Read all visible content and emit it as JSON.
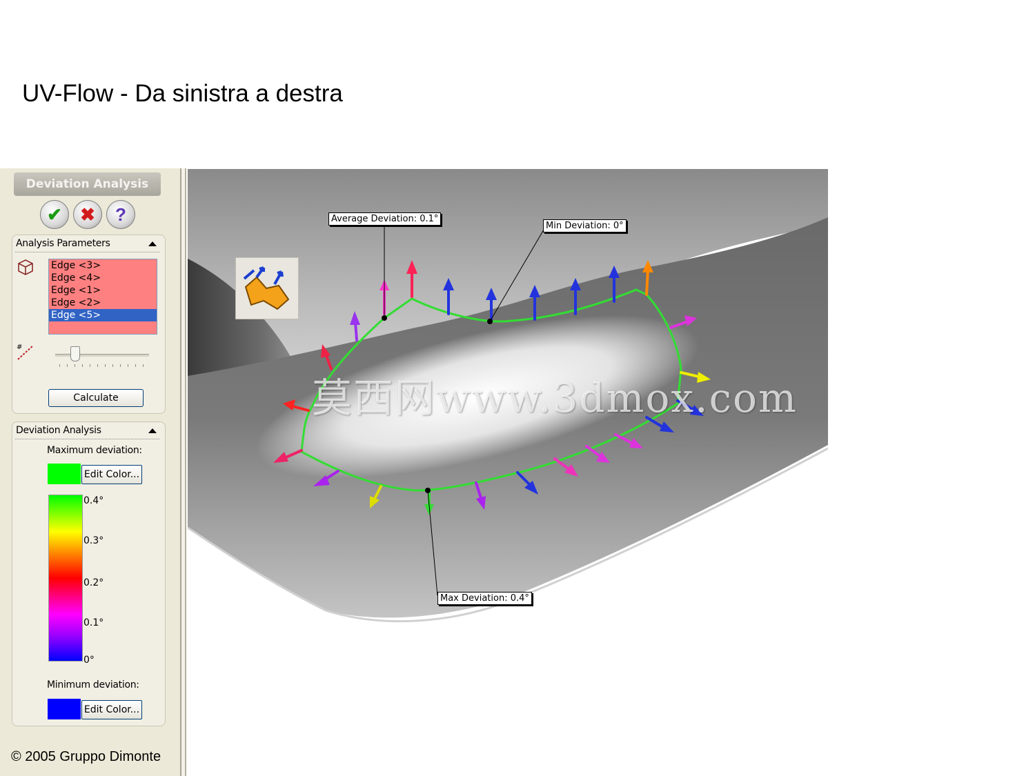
{
  "slide": {
    "title": "UV-Flow - Da sinistra a destra",
    "copyright": "© 2005 Gruppo Dimonte"
  },
  "property_manager": {
    "title": "Deviation Analysis",
    "buttons": {
      "ok_icon": "check-icon",
      "cancel_icon": "x-icon",
      "help_icon": "question-icon"
    },
    "analysis_parameters": {
      "header": "Analysis Parameters",
      "edges": [
        "Edge <3>",
        "Edge <4>",
        "Edge <1>",
        "Edge <2>",
        "Edge <5>"
      ],
      "selected_edge_index": 4,
      "list_color": "#ff8080",
      "calculate_label": "Calculate"
    },
    "deviation_analysis": {
      "header": "Deviation Analysis",
      "max_label": "Maximum deviation:",
      "max_color": "#00ff00",
      "edit_color_label": "Edit Color...",
      "scale": [
        "0.4°",
        "0.3°",
        "0.2°",
        "0.1°",
        "0°"
      ],
      "min_label": "Minimum deviation:",
      "min_color": "#0000ff",
      "edit_color_label_2": "Edit Color..."
    }
  },
  "viewport": {
    "callouts": {
      "average": "Average Deviation: 0.1°",
      "min": "Min Deviation: 0°",
      "max": "Max Deviation: 0.4°"
    },
    "watermark": "莫西网www.3dmox.com",
    "edge_color": "#33dd33"
  }
}
